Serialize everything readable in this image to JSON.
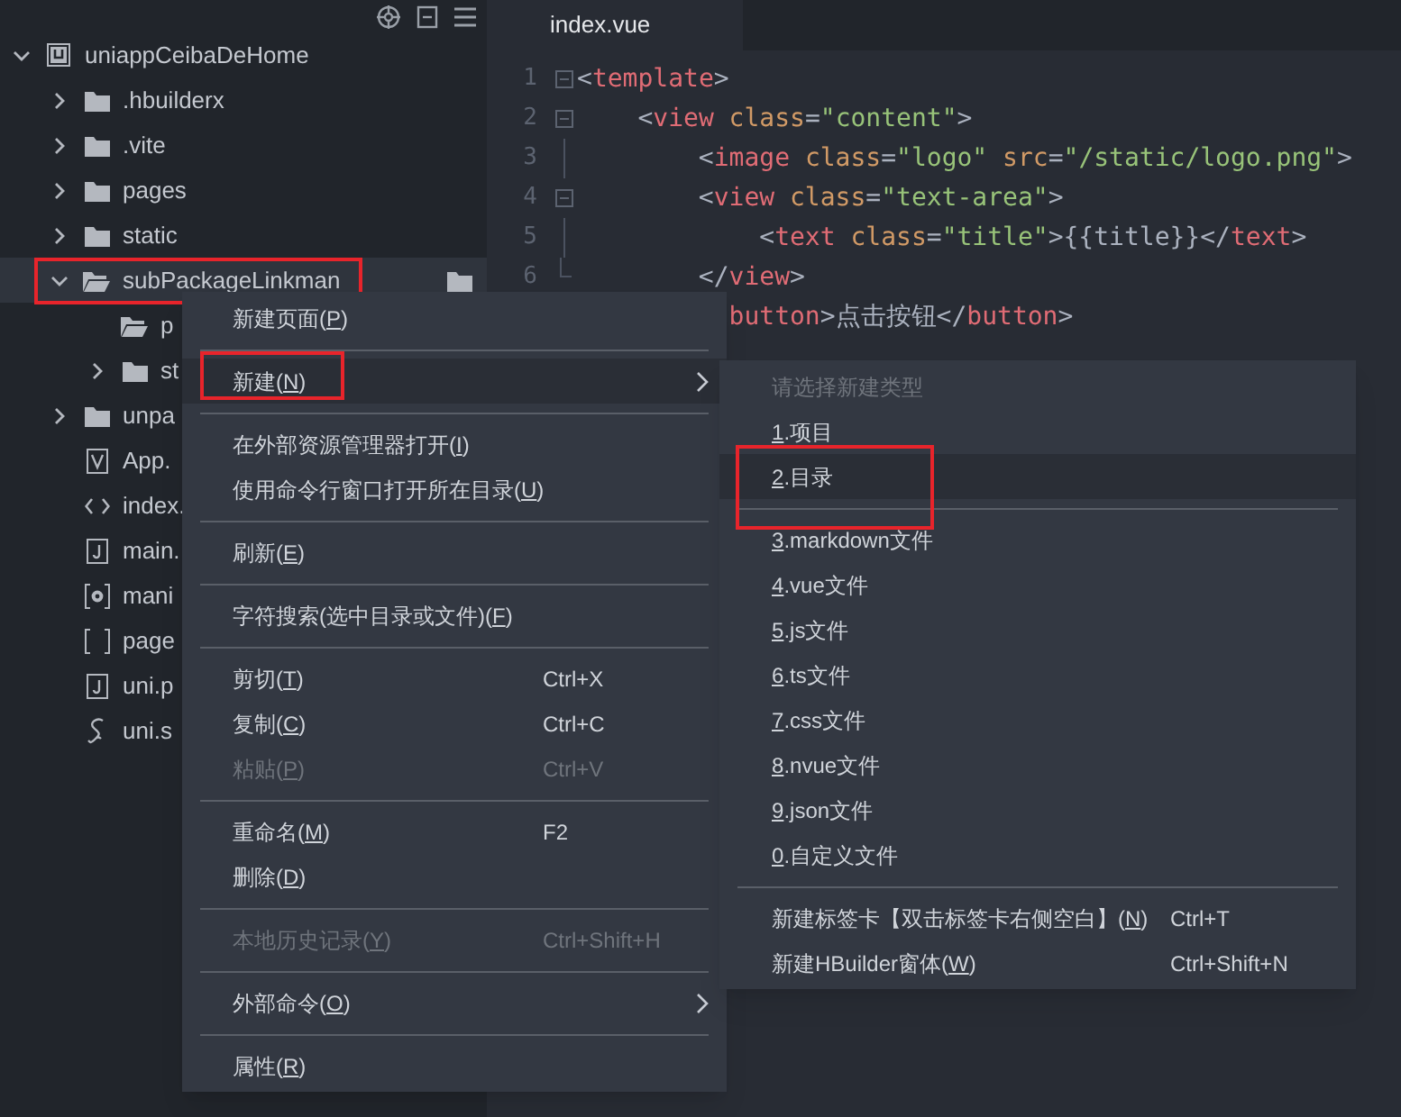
{
  "sidebar": {
    "tree": {
      "label": "uniappCeibaDeHome",
      "kind": "project",
      "expanded": true,
      "selected": false,
      "children": [
        {
          "label": ".hbuilderx",
          "kind": "folder",
          "expanded": false,
          "selected": false
        },
        {
          "label": ".vite",
          "kind": "folder",
          "expanded": false,
          "selected": false
        },
        {
          "label": "pages",
          "kind": "folder",
          "expanded": false,
          "selected": false
        },
        {
          "label": "static",
          "kind": "folder",
          "expanded": false,
          "selected": false
        },
        {
          "label": "subPackageLinkman",
          "kind": "folder",
          "expanded": true,
          "selected": true,
          "annotated": true,
          "children": [
            {
              "label": "p",
              "kind": "folder",
              "expanded": true,
              "selected": false
            },
            {
              "label": "st",
              "kind": "folder",
              "expanded": false,
              "selected": false
            }
          ]
        },
        {
          "label": "unpa",
          "kind": "folder",
          "expanded": false,
          "selected": false
        },
        {
          "label": "App.",
          "kind": "vue",
          "selected": false
        },
        {
          "label": "index.",
          "kind": "html",
          "selected": false
        },
        {
          "label": "main.",
          "kind": "js",
          "selected": false
        },
        {
          "label": "mani",
          "kind": "manifest",
          "selected": false
        },
        {
          "label": "page",
          "kind": "json",
          "selected": false
        },
        {
          "label": "uni.p",
          "kind": "js",
          "selected": false
        },
        {
          "label": "uni.s",
          "kind": "scss",
          "selected": false
        }
      ]
    }
  },
  "editor": {
    "tabs": [
      {
        "label": "index.vue",
        "selected": true
      }
    ],
    "lines": [
      {
        "number": "1",
        "collapsed": false,
        "tokens": [
          {
            "text": "<",
            "color": "#abb2bf"
          },
          {
            "text": "template",
            "color": "#e06c75"
          },
          {
            "text": ">",
            "color": "#abb2bf"
          }
        ]
      },
      {
        "number": "2",
        "collapsed": false,
        "tokens": [
          {
            "text": "    <",
            "color": "#abb2bf"
          },
          {
            "text": "view",
            "color": "#e06c75"
          },
          {
            "text": " class",
            "color": "#d19a66"
          },
          {
            "text": "=",
            "color": "#abb2bf"
          },
          {
            "text": "\"content\"",
            "color": "#98c379"
          },
          {
            "text": ">",
            "color": "#abb2bf"
          }
        ]
      },
      {
        "number": "3",
        "fold_end": false,
        "tokens": [
          {
            "text": "        <",
            "color": "#abb2bf"
          },
          {
            "text": "image",
            "color": "#e06c75"
          },
          {
            "text": " class",
            "color": "#d19a66"
          },
          {
            "text": "=",
            "color": "#abb2bf"
          },
          {
            "text": "\"logo\"",
            "color": "#98c379"
          },
          {
            "text": " src",
            "color": "#d19a66"
          },
          {
            "text": "=",
            "color": "#abb2bf"
          },
          {
            "text": "\"/static/logo.png\"",
            "color": "#98c379"
          },
          {
            "text": ">",
            "color": "#abb2bf"
          }
        ]
      },
      {
        "number": "4",
        "collapsed": false,
        "tokens": [
          {
            "text": "        <",
            "color": "#abb2bf"
          },
          {
            "text": "view",
            "color": "#e06c75"
          },
          {
            "text": " class",
            "color": "#d19a66"
          },
          {
            "text": "=",
            "color": "#abb2bf"
          },
          {
            "text": "\"text-area\"",
            "color": "#98c379"
          },
          {
            "text": ">",
            "color": "#abb2bf"
          }
        ]
      },
      {
        "number": "5",
        "fold_end": false,
        "tokens": [
          {
            "text": "            <",
            "color": "#abb2bf"
          },
          {
            "text": "text",
            "color": "#e06c75"
          },
          {
            "text": " class",
            "color": "#d19a66"
          },
          {
            "text": "=",
            "color": "#abb2bf"
          },
          {
            "text": "\"title\"",
            "color": "#98c379"
          },
          {
            "text": ">{{title}}</",
            "color": "#abb2bf"
          },
          {
            "text": "text",
            "color": "#e06c75"
          },
          {
            "text": ">",
            "color": "#abb2bf"
          }
        ]
      },
      {
        "number": "6",
        "fold_end": true,
        "tokens": [
          {
            "text": "        </",
            "color": "#abb2bf"
          },
          {
            "text": "view",
            "color": "#e06c75"
          },
          {
            "text": ">",
            "color": "#abb2bf"
          }
        ]
      },
      {
        "tokens": [
          {
            "text": "          button",
            "color": "#e06c75"
          },
          {
            "text": ">点击按钮</",
            "color": "#abb2bf"
          },
          {
            "text": "button",
            "color": "#e06c75"
          },
          {
            "text": ">",
            "color": "#abb2bf"
          }
        ]
      }
    ]
  },
  "context_menu": {
    "items": [
      {
        "kind": "item",
        "before": "新建页面(",
        "mnemonic": "P",
        "after": ")",
        "disabled": false,
        "highlighted": false
      },
      {
        "kind": "separator"
      },
      {
        "kind": "item",
        "before": "新建(",
        "mnemonic": "N",
        "after": ")",
        "submenu": true,
        "disabled": false,
        "highlighted": true,
        "annotated": true
      },
      {
        "kind": "separator"
      },
      {
        "kind": "item",
        "before": "在外部资源管理器打开(",
        "mnemonic": "I",
        "after": ")",
        "disabled": false,
        "highlighted": false
      },
      {
        "kind": "item",
        "before": "使用命令行窗口打开所在目录(",
        "mnemonic": "U",
        "after": ")",
        "disabled": false,
        "highlighted": false
      },
      {
        "kind": "separator"
      },
      {
        "kind": "item",
        "before": "刷新(",
        "mnemonic": "E",
        "after": ")",
        "disabled": false,
        "highlighted": false
      },
      {
        "kind": "separator"
      },
      {
        "kind": "item",
        "before": "字符搜索(选中目录或文件)(",
        "mnemonic": "F",
        "after": ")",
        "disabled": false,
        "highlighted": false
      },
      {
        "kind": "separator"
      },
      {
        "kind": "item",
        "before": "剪切(",
        "mnemonic": "T",
        "after": ")",
        "shortcut": "Ctrl+X",
        "disabled": false,
        "highlighted": false
      },
      {
        "kind": "item",
        "before": "复制(",
        "mnemonic": "C",
        "after": ")",
        "shortcut": "Ctrl+C",
        "disabled": false,
        "highlighted": false
      },
      {
        "kind": "item",
        "before": "粘贴(",
        "mnemonic": "P",
        "after": ")",
        "shortcut": "Ctrl+V",
        "disabled": true,
        "highlighted": false
      },
      {
        "kind": "separator"
      },
      {
        "kind": "item",
        "before": "重命名(",
        "mnemonic": "M",
        "after": ")",
        "shortcut": "F2",
        "disabled": false,
        "highlighted": false
      },
      {
        "kind": "item",
        "before": "删除(",
        "mnemonic": "D",
        "after": ")",
        "disabled": false,
        "highlighted": false
      },
      {
        "kind": "separator"
      },
      {
        "kind": "item",
        "before": "本地历史记录(",
        "mnemonic": "Y",
        "after": ")",
        "shortcut": "Ctrl+Shift+H",
        "disabled": true,
        "highlighted": false
      },
      {
        "kind": "separator"
      },
      {
        "kind": "item",
        "before": "外部命令(",
        "mnemonic": "O",
        "after": ")",
        "submenu": true,
        "disabled": false,
        "highlighted": false
      },
      {
        "kind": "separator"
      },
      {
        "kind": "item",
        "before": "属性(",
        "mnemonic": "R",
        "after": ")",
        "disabled": false,
        "highlighted": false
      }
    ]
  },
  "submenu": {
    "items": [
      {
        "kind": "header",
        "before": "请选择新建类型"
      },
      {
        "kind": "item",
        "mnemonic": "1",
        "after": ".项目",
        "disabled": false,
        "highlighted": false
      },
      {
        "kind": "item",
        "mnemonic": "2",
        "after": ".目录",
        "disabled": false,
        "highlighted": true,
        "annotated": true
      },
      {
        "kind": "separator"
      },
      {
        "kind": "item",
        "mnemonic": "3",
        "after": ".markdown文件",
        "disabled": false,
        "highlighted": false
      },
      {
        "kind": "item",
        "mnemonic": "4",
        "after": ".vue文件",
        "disabled": false,
        "highlighted": false
      },
      {
        "kind": "item",
        "mnemonic": "5",
        "after": ".js文件",
        "disabled": false,
        "highlighted": false
      },
      {
        "kind": "item",
        "mnemonic": "6",
        "after": ".ts文件",
        "disabled": false,
        "highlighted": false
      },
      {
        "kind": "item",
        "mnemonic": "7",
        "after": ".css文件",
        "disabled": false,
        "highlighted": false
      },
      {
        "kind": "item",
        "mnemonic": "8",
        "after": ".nvue文件",
        "disabled": false,
        "highlighted": false
      },
      {
        "kind": "item",
        "mnemonic": "9",
        "after": ".json文件",
        "disabled": false,
        "highlighted": false
      },
      {
        "kind": "item",
        "mnemonic": "0",
        "after": ".自定义文件",
        "disabled": false,
        "highlighted": false
      },
      {
        "kind": "separator"
      },
      {
        "kind": "item",
        "before": "新建标签卡【双击标签卡右侧空白】(",
        "mnemonic": "N",
        "after": ")",
        "shortcut": "Ctrl+T",
        "disabled": false,
        "highlighted": false
      },
      {
        "kind": "item",
        "before": "新建HBuilder窗体(",
        "mnemonic": "W",
        "after": ")",
        "shortcut": "Ctrl+Shift+N",
        "disabled": false,
        "highlighted": false
      }
    ]
  }
}
